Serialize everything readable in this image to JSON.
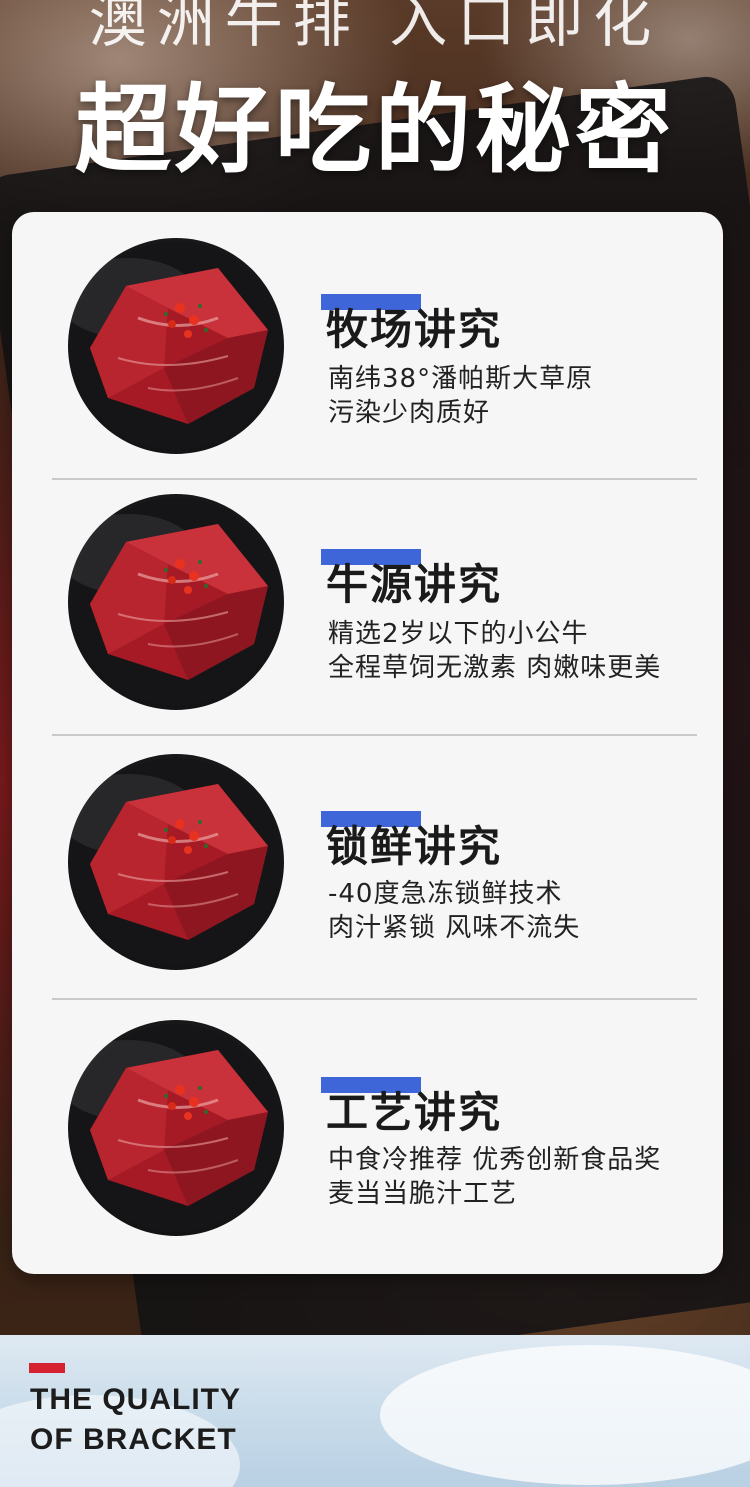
{
  "hero": {
    "slogan_top": "澳洲牛排 入口即化",
    "slogan_main": "超好吃的秘密"
  },
  "features": [
    {
      "title": "牧场讲究",
      "lines": [
        "南纬38°潘帕斯大草原",
        "污染少肉质好"
      ]
    },
    {
      "title": "牛源讲究",
      "lines": [
        "精选2岁以下的小公牛",
        "全程草饲无激素 肉嫩味更美"
      ]
    },
    {
      "title": "锁鲜讲究",
      "lines": [
        "-40度急冻锁鲜技术",
        "肉汁紧锁 风味不流失"
      ]
    },
    {
      "title": "工艺讲究",
      "lines": [
        "中食冷推荐 优秀创新食品奖",
        "麦当当脆汁工艺"
      ]
    }
  ],
  "footer": {
    "line1": "THE QUALITY",
    "line2": "OF BRACKET"
  },
  "colors": {
    "accent_blue": "#3f66d9",
    "accent_red": "#d62230",
    "card_bg": "#f6f6f6"
  }
}
